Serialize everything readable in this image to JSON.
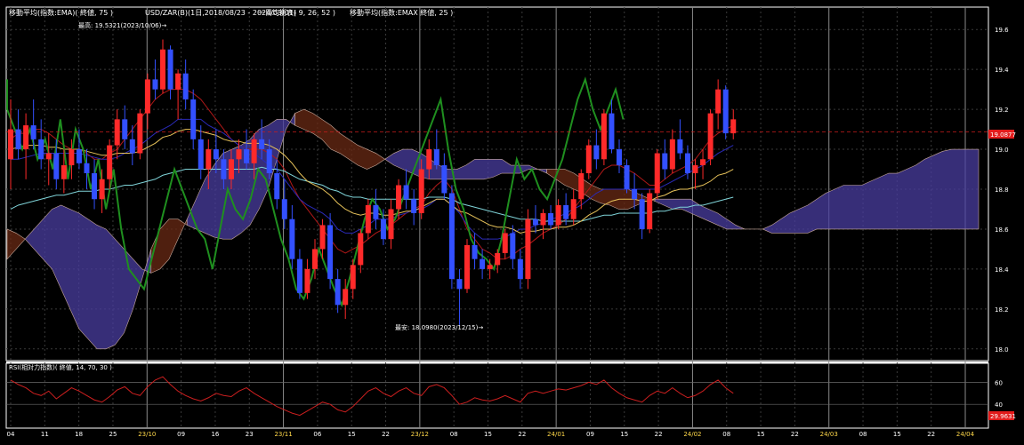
{
  "header": {
    "ema75": "移動平均(指数:EMA)( 終値, 75 )",
    "symbol": "USD/ZAR(B)(1日,2018/08/23 - 2024/03/01)",
    "ichimoku": "一目均衡表( 9, 26, 52 )",
    "ema25": "移動平均(指数:EMAX 終値, 25 )"
  },
  "annotations": {
    "high": "最高: 19.5321(2023/10/06)→",
    "low": "最安: 18.0980(2023/12/15)→"
  },
  "price_axis": {
    "ticks": [
      "19.6",
      "19.4",
      "19.2",
      "19.0",
      "18.8",
      "18.6",
      "18.4",
      "18.2",
      "18.0"
    ],
    "last_price": "19.0877"
  },
  "rsi": {
    "title": "RSI(相対力指数)( 終値, 14, 70, 30 )",
    "ticks": [
      "60",
      "40"
    ],
    "last_value": "29.9631"
  },
  "x_axis": {
    "labels": [
      {
        "text": "04",
        "major": false
      },
      {
        "text": "11",
        "major": false
      },
      {
        "text": "18",
        "major": false
      },
      {
        "text": "25",
        "major": false
      },
      {
        "text": "23/10",
        "major": true
      },
      {
        "text": "09",
        "major": false
      },
      {
        "text": "16",
        "major": false
      },
      {
        "text": "23",
        "major": false
      },
      {
        "text": "23/11",
        "major": true
      },
      {
        "text": "06",
        "major": false
      },
      {
        "text": "15",
        "major": false
      },
      {
        "text": "22",
        "major": false
      },
      {
        "text": "23/12",
        "major": true
      },
      {
        "text": "08",
        "major": false
      },
      {
        "text": "15",
        "major": false
      },
      {
        "text": "22",
        "major": false
      },
      {
        "text": "24/01",
        "major": true
      },
      {
        "text": "09",
        "major": false
      },
      {
        "text": "15",
        "major": false
      },
      {
        "text": "22",
        "major": false
      },
      {
        "text": "24/02",
        "major": true
      },
      {
        "text": "08",
        "major": false
      },
      {
        "text": "15",
        "major": false
      },
      {
        "text": "22",
        "major": false
      },
      {
        "text": "24/03",
        "major": true
      },
      {
        "text": "08",
        "major": false
      },
      {
        "text": "15",
        "major": false
      },
      {
        "text": "22",
        "major": false
      },
      {
        "text": "24/04",
        "major": true
      }
    ]
  },
  "colors": {
    "up": "#ff2a2a",
    "down": "#3350ff",
    "rsi": "#cc1f1f",
    "ema25": "#e8c35a",
    "ema75": "#7fd3d8",
    "lagging": "#1f8f1f",
    "tenkan": "#b01818",
    "kijun": "#2a2ab8",
    "cloud_bull": "#4a3ea0",
    "cloud_bear": "#6a2a14"
  },
  "chart_data": {
    "type": "candlestick",
    "y_range": [
      17.95,
      19.65
    ],
    "candles": [
      [
        18.95,
        19.25,
        18.8,
        19.1
      ],
      [
        19.1,
        19.2,
        18.95,
        19.0
      ],
      [
        19.0,
        19.18,
        18.85,
        19.12
      ],
      [
        19.12,
        19.25,
        19.0,
        19.05
      ],
      [
        19.05,
        19.15,
        18.9,
        18.95
      ],
      [
        18.95,
        19.08,
        18.82,
        18.98
      ],
      [
        18.98,
        19.05,
        18.8,
        18.85
      ],
      [
        18.85,
        19.0,
        18.78,
        18.92
      ],
      [
        18.92,
        19.05,
        18.85,
        19.0
      ],
      [
        19.0,
        19.1,
        18.9,
        18.93
      ],
      [
        18.93,
        19.0,
        18.8,
        18.88
      ],
      [
        18.88,
        18.95,
        18.7,
        18.75
      ],
      [
        18.75,
        18.9,
        18.68,
        18.85
      ],
      [
        18.85,
        19.05,
        18.8,
        19.02
      ],
      [
        19.02,
        19.2,
        18.95,
        19.15
      ],
      [
        19.15,
        19.22,
        19.0,
        19.05
      ],
      [
        19.05,
        19.12,
        18.92,
        18.98
      ],
      [
        18.98,
        19.2,
        18.95,
        19.18
      ],
      [
        19.18,
        19.38,
        19.1,
        19.35
      ],
      [
        19.35,
        19.45,
        19.25,
        19.3
      ],
      [
        19.3,
        19.55,
        19.28,
        19.5
      ],
      [
        19.5,
        19.52,
        19.25,
        19.3
      ],
      [
        19.3,
        19.4,
        19.15,
        19.38
      ],
      [
        19.38,
        19.45,
        19.2,
        19.25
      ],
      [
        19.25,
        19.3,
        19.0,
        19.05
      ],
      [
        19.05,
        19.12,
        18.85,
        18.9
      ],
      [
        18.9,
        19.05,
        18.8,
        19.0
      ],
      [
        19.0,
        19.1,
        18.88,
        18.95
      ],
      [
        18.95,
        19.0,
        18.8,
        18.85
      ],
      [
        18.85,
        19.0,
        18.8,
        18.95
      ],
      [
        18.95,
        19.05,
        18.88,
        19.0
      ],
      [
        19.0,
        19.1,
        18.9,
        18.93
      ],
      [
        18.93,
        19.08,
        18.85,
        19.05
      ],
      [
        19.05,
        19.15,
        18.95,
        19.0
      ],
      [
        19.0,
        19.05,
        18.85,
        18.88
      ],
      [
        18.88,
        18.95,
        18.7,
        18.75
      ],
      [
        18.75,
        18.85,
        18.6,
        18.65
      ],
      [
        18.65,
        18.72,
        18.4,
        18.45
      ],
      [
        18.45,
        18.5,
        18.25,
        18.28
      ],
      [
        18.28,
        18.45,
        18.25,
        18.4
      ],
      [
        18.4,
        18.55,
        18.35,
        18.5
      ],
      [
        18.5,
        18.65,
        18.45,
        18.62
      ],
      [
        18.62,
        18.68,
        18.3,
        18.35
      ],
      [
        18.35,
        18.4,
        18.18,
        18.22
      ],
      [
        18.22,
        18.35,
        18.15,
        18.3
      ],
      [
        18.3,
        18.45,
        18.25,
        18.42
      ],
      [
        18.42,
        18.6,
        18.38,
        18.58
      ],
      [
        18.58,
        18.75,
        18.55,
        18.72
      ],
      [
        18.72,
        18.8,
        18.6,
        18.65
      ],
      [
        18.65,
        18.7,
        18.52,
        18.55
      ],
      [
        18.55,
        18.75,
        18.5,
        18.7
      ],
      [
        18.7,
        18.85,
        18.65,
        18.82
      ],
      [
        18.82,
        18.9,
        18.7,
        18.75
      ],
      [
        18.75,
        18.8,
        18.62,
        18.68
      ],
      [
        18.68,
        18.95,
        18.65,
        18.9
      ],
      [
        18.9,
        19.05,
        18.85,
        19.0
      ],
      [
        19.0,
        19.1,
        18.9,
        18.92
      ],
      [
        18.92,
        18.98,
        18.75,
        18.78
      ],
      [
        18.78,
        18.82,
        18.3,
        18.35
      ],
      [
        18.35,
        18.4,
        18.12,
        18.3
      ],
      [
        18.3,
        18.55,
        18.28,
        18.52
      ],
      [
        18.52,
        18.58,
        18.4,
        18.45
      ],
      [
        18.45,
        18.5,
        18.35,
        18.4
      ],
      [
        18.4,
        18.45,
        18.35,
        18.42
      ],
      [
        18.42,
        18.5,
        18.38,
        18.48
      ],
      [
        18.48,
        18.6,
        18.45,
        18.58
      ],
      [
        18.58,
        18.62,
        18.4,
        18.45
      ],
      [
        18.45,
        18.5,
        18.3,
        18.35
      ],
      [
        18.35,
        18.7,
        18.3,
        18.65
      ],
      [
        18.65,
        18.72,
        18.58,
        18.62
      ],
      [
        18.62,
        18.7,
        18.55,
        18.68
      ],
      [
        18.68,
        18.72,
        18.6,
        18.62
      ],
      [
        18.62,
        18.75,
        18.6,
        18.72
      ],
      [
        18.72,
        18.78,
        18.62,
        18.65
      ],
      [
        18.65,
        18.8,
        18.62,
        18.75
      ],
      [
        18.75,
        18.9,
        18.7,
        18.88
      ],
      [
        18.88,
        19.05,
        18.85,
        19.02
      ],
      [
        19.02,
        19.1,
        18.9,
        18.95
      ],
      [
        18.95,
        19.2,
        18.92,
        19.18
      ],
      [
        19.18,
        19.25,
        18.98,
        19.0
      ],
      [
        19.0,
        19.05,
        18.88,
        18.92
      ],
      [
        18.92,
        18.95,
        18.78,
        18.8
      ],
      [
        18.8,
        18.88,
        18.7,
        18.75
      ],
      [
        18.75,
        18.78,
        18.55,
        18.6
      ],
      [
        18.6,
        18.8,
        18.58,
        18.78
      ],
      [
        18.78,
        19.0,
        18.75,
        18.98
      ],
      [
        18.98,
        19.05,
        18.85,
        18.9
      ],
      [
        18.9,
        19.1,
        18.88,
        19.05
      ],
      [
        19.05,
        19.15,
        18.95,
        18.98
      ],
      [
        18.98,
        19.02,
        18.85,
        18.88
      ],
      [
        18.88,
        18.95,
        18.8,
        18.92
      ],
      [
        18.92,
        19.0,
        18.85,
        18.95
      ],
      [
        18.95,
        19.2,
        18.92,
        19.18
      ],
      [
        19.18,
        19.35,
        19.1,
        19.3
      ],
      [
        19.3,
        19.32,
        19.05,
        19.08
      ],
      [
        19.08,
        19.2,
        19.05,
        19.15
      ]
    ],
    "ema25": [
      19.0,
      19.01,
      19.02,
      19.02,
      19.02,
      19.01,
      19.01,
      19.0,
      19.0,
      19.0,
      18.99,
      18.98,
      18.97,
      18.97,
      18.98,
      18.98,
      18.98,
      18.99,
      19.01,
      19.03,
      19.06,
      19.07,
      19.09,
      19.1,
      19.1,
      19.09,
      19.08,
      19.07,
      19.05,
      19.04,
      19.04,
      19.03,
      19.03,
      19.03,
      19.02,
      19.0,
      18.97,
      18.93,
      18.88,
      18.84,
      18.82,
      18.8,
      18.77,
      18.73,
      18.7,
      18.68,
      18.67,
      18.68,
      18.68,
      18.67,
      18.67,
      18.68,
      18.69,
      18.69,
      18.71,
      18.73,
      18.75,
      18.75,
      18.72,
      18.69,
      18.68,
      18.66,
      18.64,
      18.62,
      18.61,
      18.61,
      18.6,
      18.58,
      18.59,
      18.59,
      18.6,
      18.6,
      18.61,
      18.61,
      18.62,
      18.64,
      18.67,
      18.69,
      18.72,
      18.74,
      18.75,
      18.75,
      18.75,
      18.74,
      18.74,
      18.76,
      18.77,
      18.79,
      18.8,
      18.8,
      18.81,
      18.82,
      18.84,
      18.87,
      18.88,
      18.9
    ],
    "ema75": [
      18.7,
      18.72,
      18.73,
      18.74,
      18.75,
      18.76,
      18.77,
      18.77,
      18.78,
      18.79,
      18.79,
      18.79,
      18.8,
      18.8,
      18.81,
      18.82,
      18.82,
      18.83,
      18.84,
      18.85,
      18.87,
      18.88,
      18.89,
      18.9,
      18.9,
      18.9,
      18.9,
      18.9,
      18.9,
      18.9,
      18.9,
      18.9,
      18.9,
      18.91,
      18.9,
      18.9,
      18.89,
      18.87,
      18.85,
      18.84,
      18.83,
      18.82,
      18.8,
      18.79,
      18.77,
      18.76,
      18.76,
      18.75,
      18.75,
      18.75,
      18.75,
      18.75,
      18.75,
      18.75,
      18.75,
      18.76,
      18.76,
      18.76,
      18.75,
      18.73,
      18.72,
      18.71,
      18.7,
      18.69,
      18.68,
      18.67,
      18.66,
      18.65,
      18.65,
      18.65,
      18.64,
      18.64,
      18.64,
      18.64,
      18.64,
      18.64,
      18.65,
      18.66,
      18.67,
      18.67,
      18.68,
      18.68,
      18.68,
      18.68,
      18.68,
      18.69,
      18.69,
      18.7,
      18.71,
      18.71,
      18.72,
      18.72,
      18.73,
      18.74,
      18.75,
      18.76
    ],
    "tenkan": [
      19.05,
      19.08,
      19.08,
      19.1,
      19.1,
      19.08,
      19.05,
      19.02,
      19.0,
      19.0,
      18.98,
      18.95,
      18.95,
      18.98,
      19.0,
      19.05,
      19.1,
      19.15,
      19.2,
      19.25,
      19.28,
      19.3,
      19.3,
      19.3,
      19.28,
      19.25,
      19.2,
      19.15,
      19.1,
      19.05,
      19.02,
      19.0,
      19.0,
      19.0,
      18.98,
      18.95,
      18.9,
      18.82,
      18.75,
      18.7,
      18.65,
      18.6,
      18.55,
      18.5,
      18.48,
      18.5,
      18.52,
      18.55,
      18.58,
      18.6,
      18.62,
      18.65,
      18.68,
      18.7,
      18.72,
      18.78,
      18.82,
      18.85,
      18.8,
      18.7,
      18.6,
      18.55,
      18.5,
      18.48,
      18.45,
      18.45,
      18.47,
      18.5,
      18.52,
      18.55,
      18.58,
      18.6,
      18.62,
      18.65,
      18.7,
      18.75,
      18.8,
      18.85,
      18.9,
      18.92,
      18.92,
      18.9,
      18.88,
      18.85,
      18.82,
      18.82,
      18.85,
      18.88,
      18.9,
      18.92,
      18.95,
      19.0,
      19.05,
      19.08,
      19.1,
      19.12
    ],
    "kijun": [
      18.95,
      18.95,
      18.96,
      18.97,
      18.98,
      18.98,
      18.98,
      18.98,
      18.98,
      18.98,
      18.97,
      18.96,
      18.95,
      18.95,
      18.96,
      18.98,
      19.0,
      19.02,
      19.05,
      19.08,
      19.1,
      19.12,
      19.15,
      19.15,
      19.15,
      19.15,
      19.12,
      19.1,
      19.08,
      19.05,
      19.02,
      19.0,
      18.98,
      18.95,
      18.92,
      18.9,
      18.85,
      18.8,
      18.75,
      18.72,
      18.7,
      18.68,
      18.65,
      18.6,
      18.58,
      18.58,
      18.6,
      18.62,
      18.65,
      18.65,
      18.65,
      18.67,
      18.68,
      18.7,
      18.7,
      18.72,
      18.75,
      18.75,
      18.72,
      18.68,
      18.62,
      18.58,
      18.55,
      18.55,
      18.55,
      18.56,
      18.58,
      18.6,
      18.6,
      18.62,
      18.63,
      18.65,
      18.66,
      18.68,
      18.7,
      18.72,
      18.75,
      18.78,
      18.8,
      18.8,
      18.8,
      18.8,
      18.8,
      18.8,
      18.8,
      18.8,
      18.82,
      18.84,
      18.86,
      18.88,
      18.9,
      18.92,
      18.95,
      18.98,
      19.0,
      19.02
    ],
    "lagging": [
      19.35,
      19.2,
      19.0,
      19.1,
      18.95,
      19.05,
      18.9,
      19.15,
      18.85,
      19.1,
      19.0,
      18.8,
      18.95,
      18.7,
      18.9,
      18.6,
      18.4,
      18.35,
      18.3,
      18.45,
      18.6,
      18.75,
      18.9,
      18.8,
      18.7,
      18.6,
      18.55,
      18.4,
      18.6,
      18.8,
      18.7,
      18.65,
      18.75,
      18.9,
      18.85,
      18.7,
      18.55,
      18.45,
      18.3,
      18.25,
      18.35,
      18.5,
      18.4,
      18.3,
      18.22,
      18.35,
      18.5,
      18.65,
      18.75,
      18.7,
      18.6,
      18.65,
      18.75,
      18.85,
      18.95,
      19.05,
      19.15,
      19.25,
      19.0,
      18.8,
      18.7,
      18.55,
      18.48,
      18.45,
      18.4,
      18.55,
      18.75,
      18.95,
      18.85,
      18.9,
      18.8,
      18.75,
      18.85,
      18.95,
      19.1,
      19.25,
      19.35,
      19.2,
      19.1,
      19.2,
      19.3,
      19.15
    ],
    "span_a": [
      18.45,
      18.5,
      18.55,
      18.6,
      18.65,
      18.7,
      18.72,
      18.7,
      18.68,
      18.65,
      18.62,
      18.6,
      18.55,
      18.5,
      18.45,
      18.4,
      18.38,
      18.4,
      18.45,
      18.55,
      18.65,
      18.75,
      18.85,
      18.92,
      18.98,
      19.0,
      19.02,
      19.05,
      19.1,
      19.12,
      19.15,
      19.15,
      19.12,
      19.1,
      19.08,
      19.05,
      19.0,
      18.98,
      18.95,
      18.92,
      18.9,
      18.92,
      18.95,
      18.98,
      19.0,
      19.0,
      18.98,
      18.95,
      18.92,
      18.9,
      18.9,
      18.92,
      18.95,
      18.95,
      18.95,
      18.95,
      18.92,
      18.92,
      18.92,
      18.9,
      18.88,
      18.85,
      18.82,
      18.8,
      18.78,
      18.75,
      18.73,
      18.72,
      18.7,
      18.7,
      18.72,
      18.74,
      18.75,
      18.75,
      18.75,
      18.75,
      18.75,
      18.72,
      18.7,
      18.68,
      18.65,
      18.62,
      18.6,
      18.6,
      18.6,
      18.62,
      18.65,
      18.68,
      18.7,
      18.72,
      18.75,
      18.78,
      18.8,
      18.82,
      18.82,
      18.82,
      18.84,
      18.86,
      18.88,
      18.88,
      18.9,
      18.92,
      18.95,
      18.97,
      18.99,
      19.0,
      19.0,
      19.0,
      19.0
    ],
    "span_b": [
      18.6,
      18.58,
      18.55,
      18.5,
      18.45,
      18.4,
      18.3,
      18.2,
      18.1,
      18.05,
      18.0,
      18.0,
      18.02,
      18.08,
      18.2,
      18.35,
      18.5,
      18.6,
      18.65,
      18.65,
      18.62,
      18.6,
      18.58,
      18.56,
      18.55,
      18.55,
      18.58,
      18.62,
      18.7,
      18.8,
      18.95,
      19.1,
      19.18,
      19.2,
      19.18,
      19.15,
      19.12,
      19.08,
      19.05,
      19.02,
      19.0,
      18.98,
      18.95,
      18.92,
      18.9,
      18.88,
      18.86,
      18.85,
      18.85,
      18.85,
      18.85,
      18.85,
      18.85,
      18.85,
      18.86,
      18.88,
      18.88,
      18.88,
      18.9,
      18.9,
      18.9,
      18.9,
      18.9,
      18.88,
      18.85,
      18.82,
      18.8,
      18.8,
      18.8,
      18.8,
      18.78,
      18.76,
      18.74,
      18.72,
      18.7,
      18.7,
      18.68,
      18.66,
      18.64,
      18.62,
      18.6,
      18.6,
      18.6,
      18.6,
      18.6,
      18.58,
      18.58,
      18.58,
      18.58,
      18.58,
      18.6,
      18.6,
      18.6,
      18.6,
      18.6,
      18.6,
      18.6,
      18.6,
      18.6,
      18.6,
      18.6,
      18.6,
      18.6,
      18.6,
      18.6,
      18.6,
      18.6,
      18.6,
      18.6
    ],
    "rsi": [
      62,
      58,
      55,
      50,
      48,
      52,
      45,
      50,
      55,
      52,
      48,
      44,
      42,
      47,
      53,
      56,
      50,
      48,
      56,
      62,
      65,
      58,
      52,
      48,
      45,
      43,
      46,
      50,
      48,
      47,
      52,
      55,
      50,
      46,
      42,
      38,
      35,
      32,
      30,
      34,
      38,
      42,
      40,
      35,
      33,
      38,
      45,
      52,
      55,
      50,
      47,
      52,
      55,
      50,
      48,
      56,
      58,
      55,
      48,
      40,
      42,
      46,
      44,
      43,
      45,
      48,
      45,
      42,
      50,
      52,
      50,
      52,
      54,
      53,
      55,
      57,
      60,
      58,
      62,
      55,
      50,
      46,
      44,
      42,
      48,
      52,
      50,
      55,
      50,
      46,
      48,
      52,
      58,
      62,
      55,
      50
    ]
  }
}
